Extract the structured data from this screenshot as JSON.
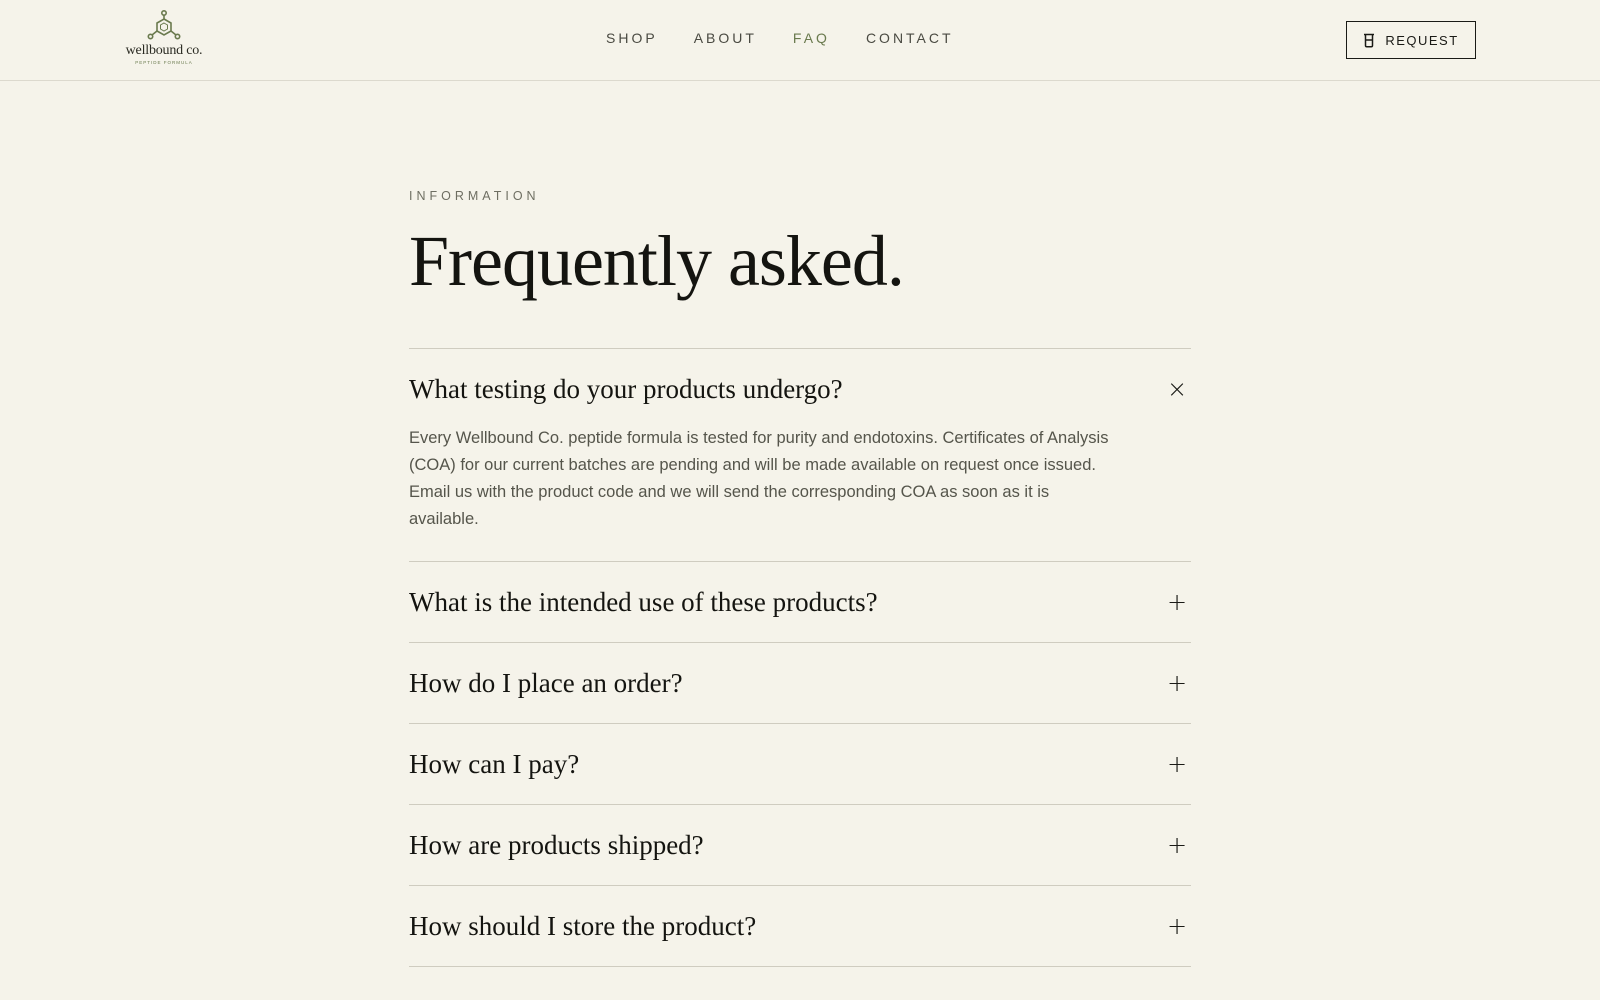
{
  "brand": {
    "name": "wellbound co.",
    "tagline": "PEPTIDE FORMULA"
  },
  "nav": {
    "items": [
      {
        "label": "SHOP"
      },
      {
        "label": "ABOUT"
      },
      {
        "label": "FAQ"
      },
      {
        "label": "CONTACT"
      }
    ],
    "active": "FAQ"
  },
  "header": {
    "request_label": "REQUEST"
  },
  "main": {
    "eyebrow": "INFORMATION",
    "title": "Frequently asked.",
    "faqs": [
      {
        "question": "What testing do your products undergo?",
        "answer": "Every Wellbound Co. peptide formula is tested for purity and endotoxins. Certificates of Analysis (COA) for our current batches are pending and will be made available on request once issued. Email us with the product code and we will send the corresponding COA as soon as it is available.",
        "open": true,
        "toggle": "×"
      },
      {
        "question": "What is the intended use of these products?",
        "open": false,
        "toggle": "+"
      },
      {
        "question": "How do I place an order?",
        "open": false,
        "toggle": "+"
      },
      {
        "question": "How can I pay?",
        "open": false,
        "toggle": "+"
      },
      {
        "question": "How are products shipped?",
        "open": false,
        "toggle": "+"
      },
      {
        "question": "How should I store the product?",
        "open": false,
        "toggle": "+"
      }
    ]
  },
  "colors": {
    "background": "#f5f3ea",
    "accent": "#6a7a4e",
    "text": "#141410"
  }
}
